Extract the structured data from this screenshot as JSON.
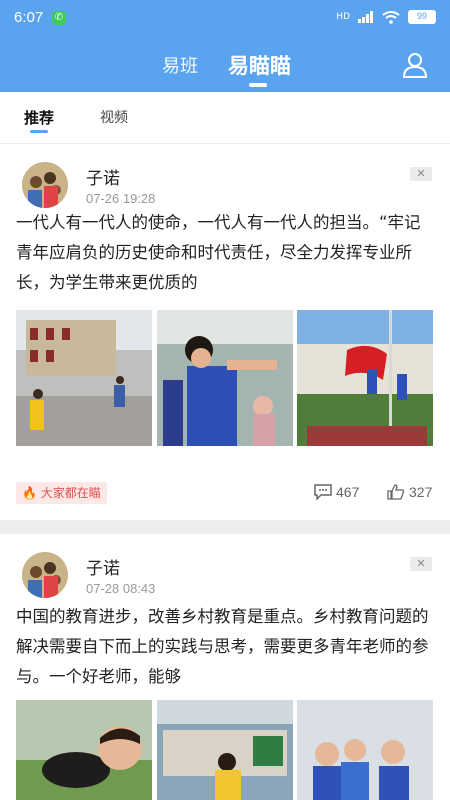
{
  "status": {
    "time": "6:07",
    "battery": "99",
    "net": "HD"
  },
  "header": {
    "tabs": [
      "易班",
      "易瞄瞄"
    ],
    "active": 1
  },
  "subtabs": [
    "推荐",
    "视频"
  ],
  "posts": [
    {
      "author": "子诺",
      "time": "07-26 19:28",
      "text": "一代人有一代人的使命，一代人有一代人的担当。“牢记青年应肩负的历史使命和时代责任，尽全力发挥专业所长，为学生带来更优质的",
      "tag": "大家都在瞄",
      "comments": "467",
      "likes": "327"
    },
    {
      "author": "子诺",
      "time": "07-28 08:43",
      "text": "中国的教育进步，改善乡村教育是重点。乡村教育问题的解决需要自下而上的实践与思考，需要更多青年老师的参与。一个好老师，能够"
    }
  ],
  "colors": {
    "brand": "#5aa4ef",
    "tag_bg": "#fde8e8",
    "tag_fg": "#e25050"
  }
}
